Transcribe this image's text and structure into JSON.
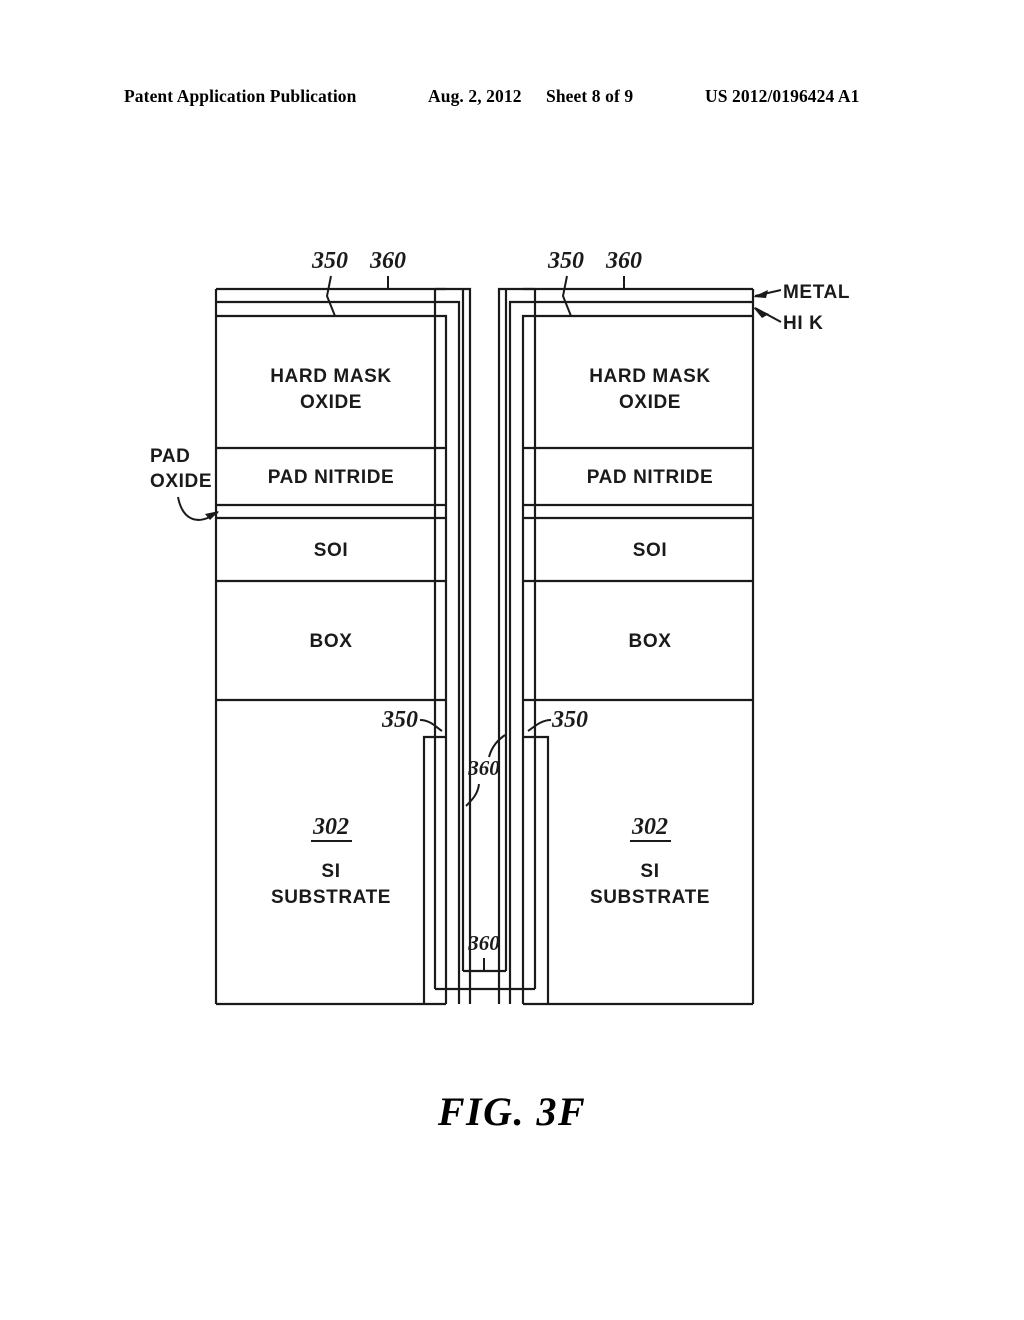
{
  "header": {
    "publication": "Patent Application Publication",
    "date": "Aug. 2, 2012",
    "sheet": "Sheet 8 of 9",
    "publication_number": "US 2012/0196424 A1"
  },
  "figure": {
    "caption": "FIG.  3F",
    "stack_labels": {
      "hard_mask_line1": "HARD MASK",
      "hard_mask_line2": "OXIDE",
      "pad_nitride": "PAD NITRIDE",
      "soi": "SOI",
      "box": "BOX",
      "substrate_ref": "302",
      "substrate_line1": "SI",
      "substrate_line2": "SUBSTRATE"
    },
    "callouts": {
      "metal": "METAL",
      "hi_k": "HI K",
      "pad_oxide_line1": "PAD",
      "pad_oxide_line2": "OXIDE"
    },
    "reference_numerals": {
      "liner_350": "350",
      "fill_360": "360"
    },
    "colors": {
      "ink": "#1a1a1a",
      "background": "#ffffff"
    }
  }
}
